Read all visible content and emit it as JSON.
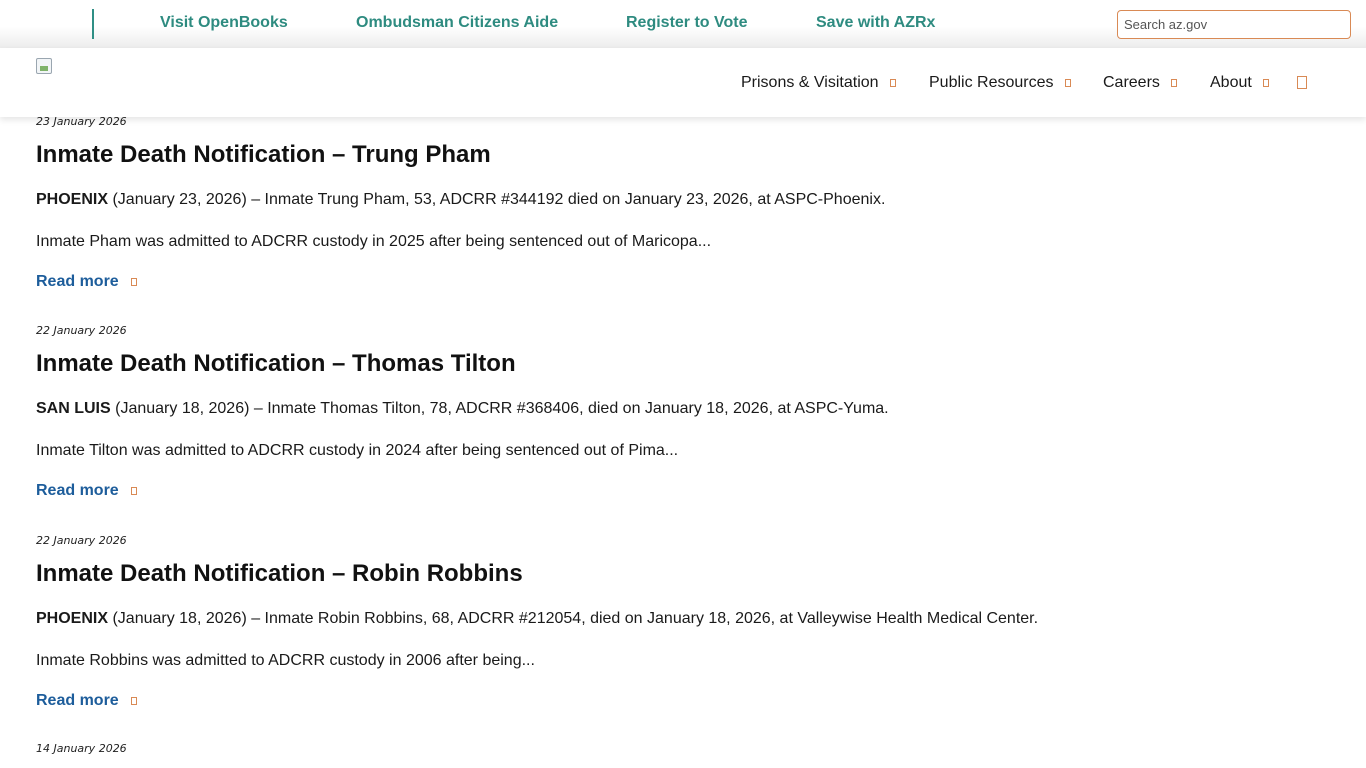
{
  "utility": {
    "links": [
      "Visit OpenBooks",
      "Ombudsman Citizens Aide",
      "Register to Vote",
      "Save with AZRx"
    ],
    "search_placeholder": "Search az.gov"
  },
  "nav": {
    "items": [
      "Prisons & Visitation",
      "Public Resources",
      "Careers",
      "About"
    ]
  },
  "articles": [
    {
      "date": "23 January 2026",
      "title": "Inmate Death Notification – Trung Pham",
      "place": "PHOENIX",
      "lead": " (January 23, 2026) – Inmate Trung Pham, 53, ADCRR #344192 died on January 23, 2026, at ASPC-Phoenix.",
      "summary": "Inmate Pham was admitted to ADCRR custody in 2025 after being sentenced out of Maricopa...",
      "read_more": "Read more"
    },
    {
      "date": "22 January 2026",
      "title": "Inmate Death Notification – Thomas Tilton",
      "place": "SAN LUIS",
      "lead": " (January 18, 2026) – Inmate Thomas Tilton, 78, ADCRR #368406, died on January 18, 2026, at ASPC-Yuma.",
      "summary": "Inmate Tilton was admitted to ADCRR custody in 2024 after being sentenced out of Pima...",
      "read_more": "Read more"
    },
    {
      "date": "22 January 2026",
      "title": "Inmate Death Notification – Robin Robbins",
      "place": "PHOENIX",
      "lead": " (January 18, 2026) – Inmate Robin Robbins, 68, ADCRR #212054, died on January 18, 2026, at Valleywise Health Medical Center.",
      "summary": "Inmate Robbins was admitted to ADCRR custody in 2006 after being...",
      "read_more": "Read more"
    }
  ],
  "next_article_date": "14 January 2026",
  "colors": {
    "utility_link": "#2e8b80",
    "read_more": "#1d5d9b",
    "accent_orange": "#d98a55"
  },
  "icons": {
    "dropdown": "chevron-down-icon",
    "search": "search-icon",
    "read_more": "arrow-right-icon",
    "logo": "broken-image-icon"
  }
}
